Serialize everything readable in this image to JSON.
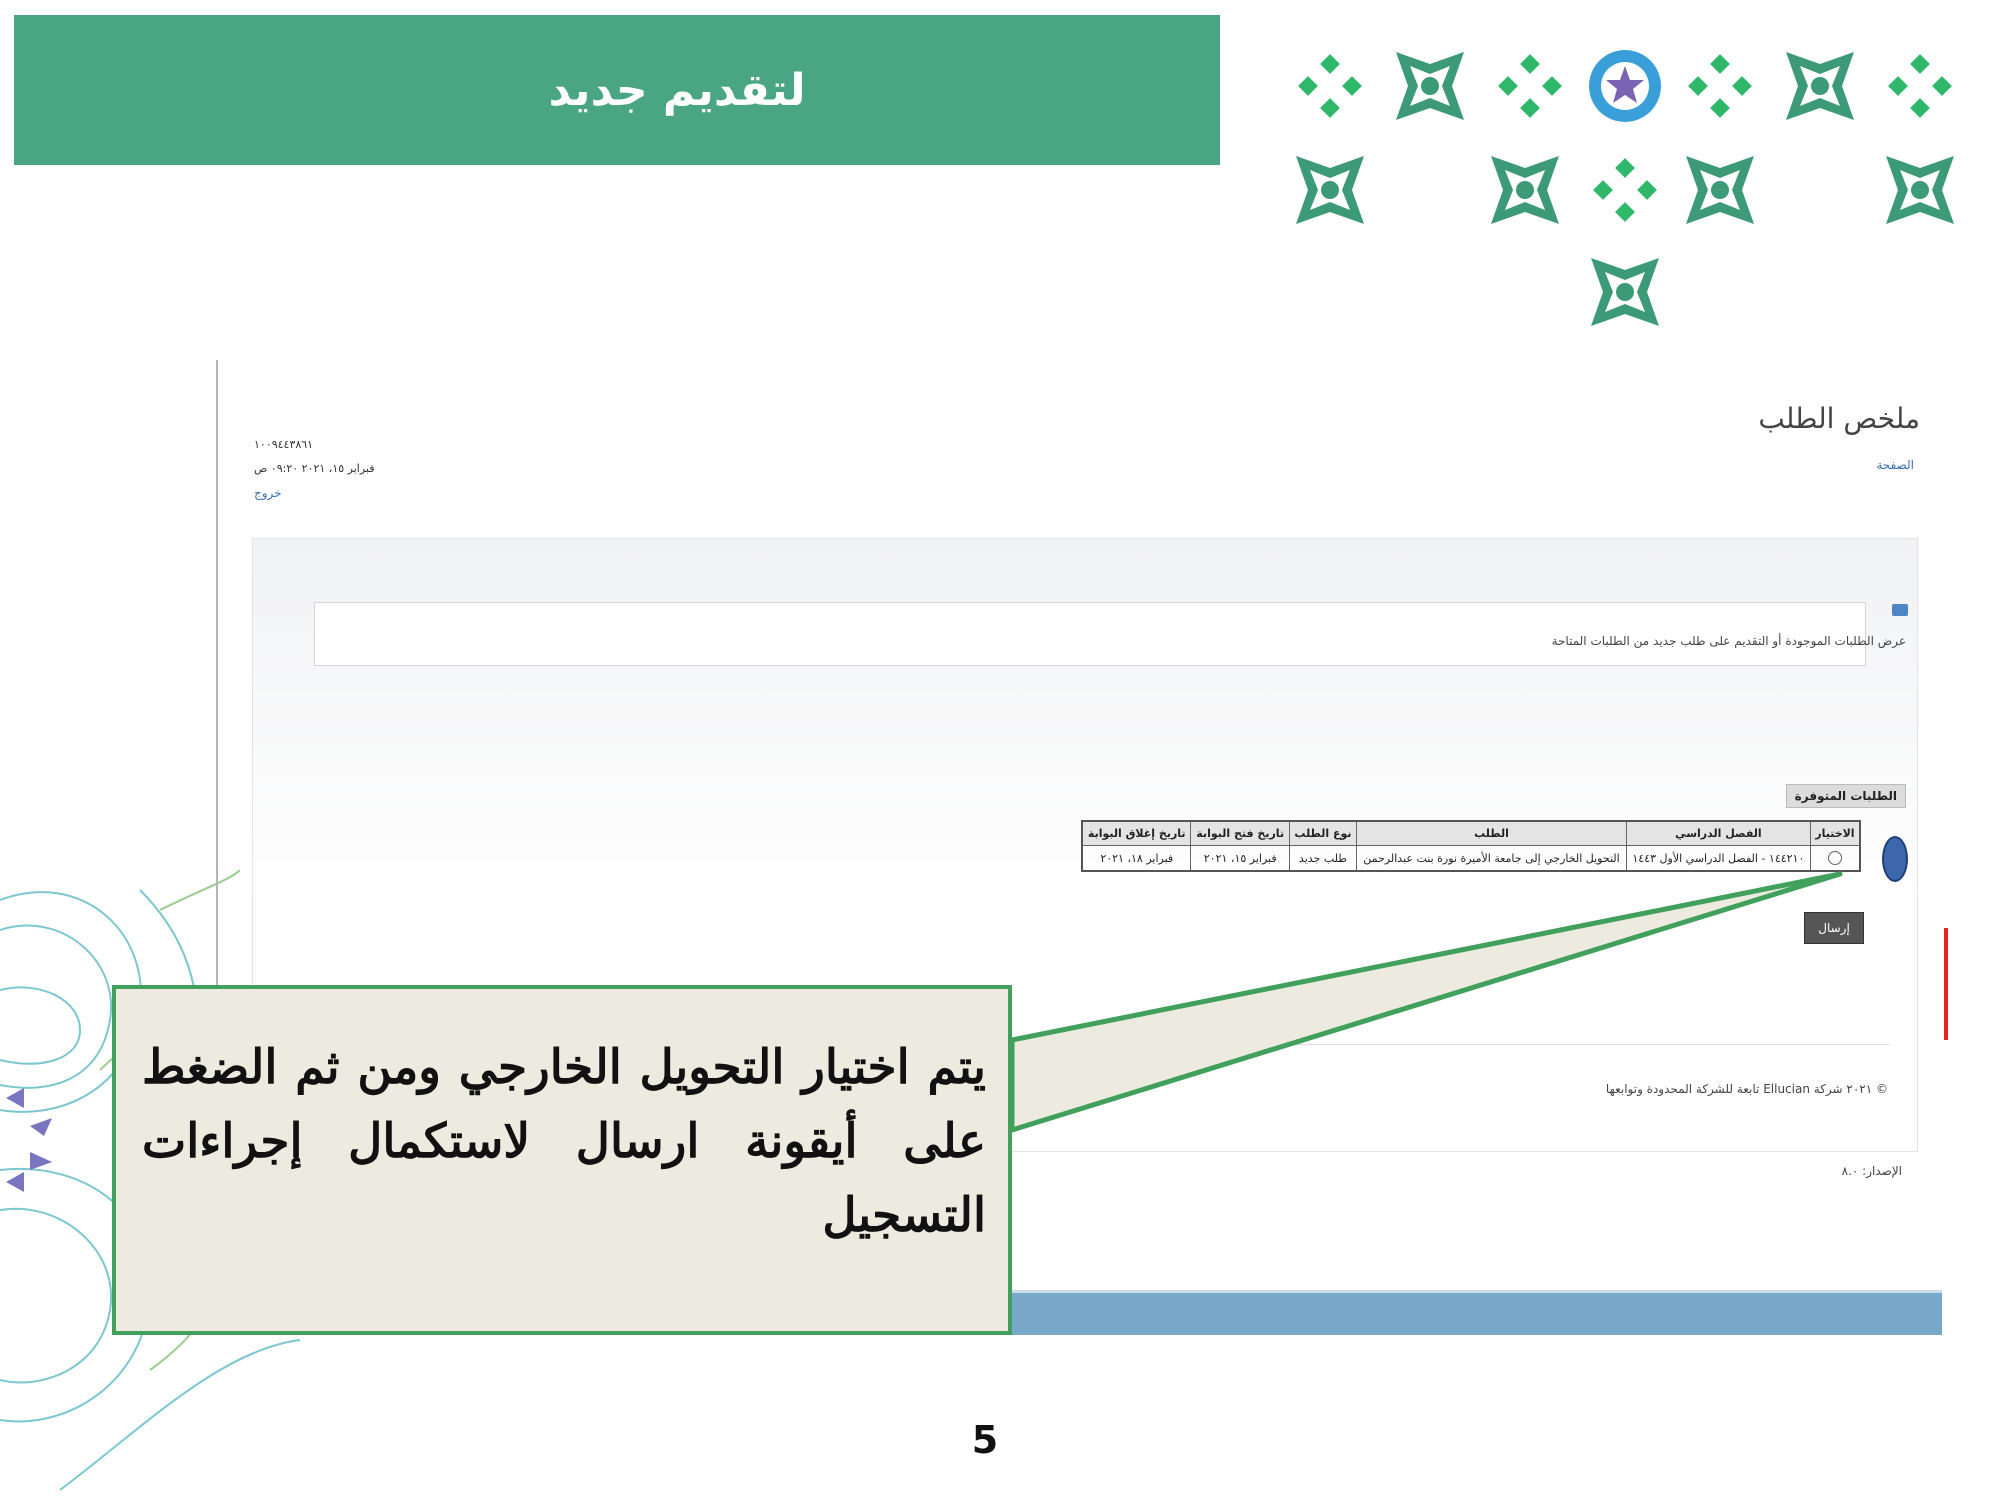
{
  "slide": {
    "title": "لتقديم جديد",
    "page_number": "5"
  },
  "screenshot": {
    "page_heading": "ملخص الطلب",
    "home_link": "الصفحة",
    "user": {
      "id": "١٠٠٩٤٤٣٨٦١",
      "date": "فبراير ١٥، ٢٠٢١ ٠٩:٢٠ ص",
      "logout": "خروج"
    },
    "info_text": "عرض الطلبات الموجودة أو التقديم على طلب جديد من الطلبات المتاحة",
    "stored_label": "الطلبات المتوفرة",
    "table": {
      "headers": [
        "الاختيار",
        "الفصل الدراسي",
        "الطلب",
        "نوع الطلب",
        "تاريخ فتح البوابة",
        "تاريخ إغلاق البوابة"
      ],
      "rows": [
        [
          "",
          "١٤٤٢١٠ - الفصل الدراسي الأول ١٤٤٣",
          "التحويل الخارجي إلى جامعة الأميرة نورة بنت عبدالرحمن",
          "طلب جديد",
          "فبراير ١٥، ٢٠٢١",
          "فبراير ١٨، ٢٠٢١"
        ]
      ]
    },
    "submit_label": "إرسال",
    "copyright": "© ٢٠٢١ شركة Ellucian تابعة للشركة المحدودة وتوابعها",
    "version": "الإصدار: ٨.٠"
  },
  "callout": {
    "text": "يتم اختيار التحويل الخارجي ومن ثم الضغط على أيقونة ارسال لاستكمال إجراءات التسجيل"
  },
  "colors": {
    "banner": "#4aa584",
    "callout_border": "#41a05c",
    "callout_fill": "#edebe0",
    "pattern_green": "#2fb86a",
    "pattern_teal": "#3c9a78",
    "pattern_blue": "#3a9fd8",
    "pattern_purple": "#7a63b3",
    "bottom_strip": "#7aa8c9"
  }
}
